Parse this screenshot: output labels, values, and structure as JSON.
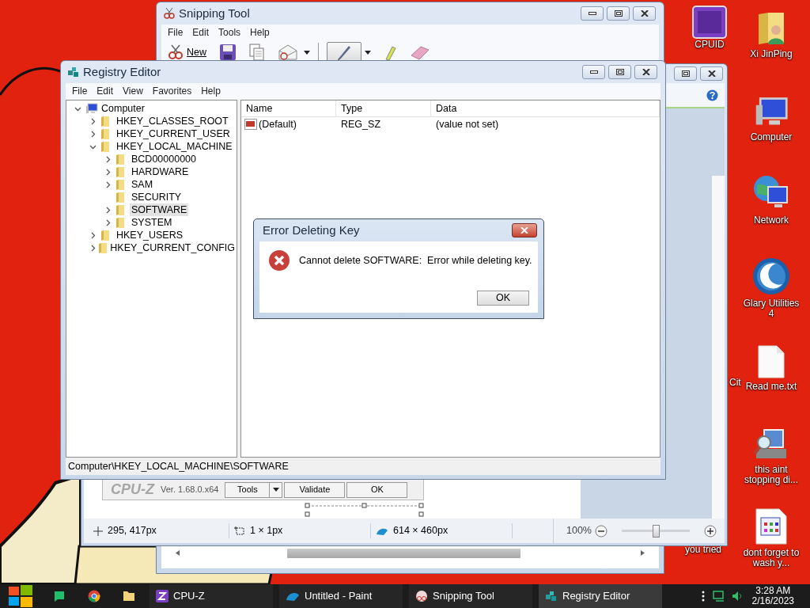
{
  "desktop": {
    "icons": [
      {
        "label": "Xi JinPing",
        "kind": "user-folder"
      },
      {
        "label": "Computer",
        "kind": "computer"
      },
      {
        "label": "Network",
        "kind": "network"
      },
      {
        "label": "Glary Utilities 4",
        "kind": "glary"
      },
      {
        "label": "Read me.txt",
        "kind": "text-file"
      },
      {
        "label": "this aint stopping di...",
        "kind": "search-computer"
      },
      {
        "label": "dont forget to wash y...",
        "kind": "app-window"
      }
    ],
    "partial_icons": [
      {
        "label": "CPUID",
        "kind": "cpuz"
      },
      {
        "label": "Cit",
        "kind": "label-only"
      },
      {
        "label": "you tried",
        "kind": "label-only"
      }
    ]
  },
  "snipping_tool": {
    "title": "Snipping Tool",
    "menu": [
      "File",
      "Edit",
      "Tools",
      "Help"
    ],
    "toolbar": [
      {
        "kind": "new",
        "label": "New",
        "selected": false,
        "dropdown": false
      },
      {
        "kind": "save",
        "selected": false,
        "dropdown": false
      },
      {
        "kind": "copy",
        "selected": false,
        "dropdown": false
      },
      {
        "kind": "send",
        "selected": false,
        "dropdown": true
      },
      {
        "kind": "pen",
        "selected": true,
        "dropdown": true
      },
      {
        "kind": "highlighter",
        "selected": false,
        "dropdown": false
      },
      {
        "kind": "eraser",
        "selected": false,
        "dropdown": false
      }
    ]
  },
  "paint": {
    "canvas_image": {
      "logo": "CPU-Z",
      "version": "Ver. 1.68.0.x64",
      "buttons": [
        {
          "label": "Tools",
          "dropdown": true
        },
        {
          "label": "Validate",
          "dropdown": false
        },
        {
          "label": "OK",
          "dropdown": false
        }
      ]
    },
    "status_bar": {
      "cursor_position": "295, 417px",
      "selection_size": "1 × 1px",
      "image_size": "614 × 460px",
      "zoom": "100%",
      "zoom_slider": {
        "level": 0.5
      }
    }
  },
  "registry_editor": {
    "title": "Registry Editor",
    "menu": [
      "File",
      "Edit",
      "View",
      "Favorites",
      "Help"
    ],
    "tree": [
      {
        "label": "Computer",
        "kind": "computer",
        "expandable": true,
        "expanded": true,
        "selected": false,
        "children": [
          {
            "label": "HKEY_CLASSES_ROOT",
            "kind": "folder",
            "expandable": true,
            "expanded": false,
            "selected": false
          },
          {
            "label": "HKEY_CURRENT_USER",
            "kind": "folder",
            "expandable": true,
            "expanded": false,
            "selected": false
          },
          {
            "label": "HKEY_LOCAL_MACHINE",
            "kind": "folder",
            "expandable": true,
            "expanded": true,
            "selected": false,
            "children": [
              {
                "label": "BCD00000000",
                "kind": "folder",
                "expandable": true,
                "expanded": false,
                "selected": false
              },
              {
                "label": "HARDWARE",
                "kind": "folder",
                "expandable": true,
                "expanded": false,
                "selected": false
              },
              {
                "label": "SAM",
                "kind": "folder",
                "expandable": true,
                "expanded": false,
                "selected": false
              },
              {
                "label": "SECURITY",
                "kind": "folder",
                "expandable": false,
                "expanded": false,
                "selected": false
              },
              {
                "label": "SOFTWARE",
                "kind": "folder",
                "expandable": true,
                "expanded": false,
                "selected": true
              },
              {
                "label": "SYSTEM",
                "kind": "folder",
                "expandable": true,
                "expanded": false,
                "selected": false
              }
            ]
          },
          {
            "label": "HKEY_USERS",
            "kind": "folder",
            "expandable": true,
            "expanded": false,
            "selected": false
          },
          {
            "label": "HKEY_CURRENT_CONFIG",
            "kind": "folder",
            "expandable": true,
            "expanded": false,
            "selected": false
          }
        ]
      }
    ],
    "list": {
      "columns": [
        "Name",
        "Type",
        "Data"
      ],
      "rows": [
        {
          "name": "(Default)",
          "type": "REG_SZ",
          "data": "(value not set)"
        }
      ]
    },
    "status_bar": "Computer\\HKEY_LOCAL_MACHINE\\SOFTWARE"
  },
  "dialog": {
    "title": "Error Deleting Key",
    "message": "Cannot delete SOFTWARE:  Error while deleting key.",
    "buttons": [
      "OK"
    ]
  },
  "taskbar": {
    "pinned": [
      {
        "kind": "chat"
      },
      {
        "kind": "chrome"
      },
      {
        "kind": "folder"
      }
    ],
    "windows": [
      {
        "label": "CPU-Z",
        "kind": "cpuz",
        "selected": false
      },
      {
        "label": "Untitled - Paint",
        "kind": "paint",
        "selected": false
      },
      {
        "label": "Snipping Tool",
        "kind": "scissors",
        "selected": false
      },
      {
        "label": "Registry Editor",
        "kind": "registry",
        "selected": true
      }
    ],
    "clock": {
      "time": "3:28 AM",
      "date": "2/16/2023"
    }
  }
}
